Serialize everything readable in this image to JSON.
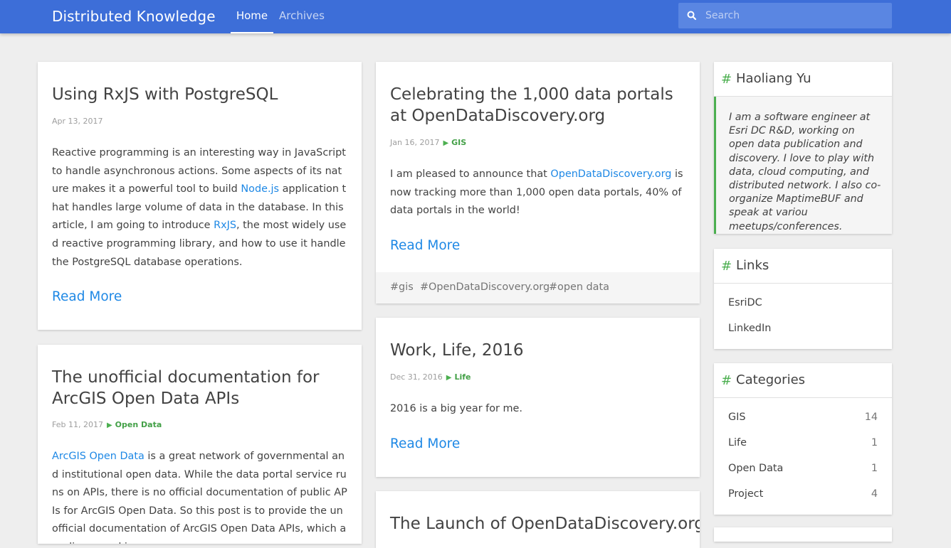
{
  "header": {
    "brand": "Distributed Knowledge",
    "nav": [
      {
        "label": "Home",
        "active": true
      },
      {
        "label": "Archives",
        "active": false
      }
    ],
    "search": {
      "placeholder": "Search",
      "icon": "search-icon"
    }
  },
  "posts_left": [
    {
      "title": "Using RxJS with PostgreSQL",
      "date": "Apr 13, 2017",
      "category": "",
      "body_parts": [
        {
          "text": "Reactive programming is an interesting way in JavaScript to handle asynchronous actions. Some aspects of its nature makes it a powerful tool to build ",
          "link": false
        },
        {
          "text": "Node.js",
          "link": true
        },
        {
          "text": " application that handles large volume of data in the database. In this article, I am going to introduce ",
          "link": false
        },
        {
          "text": "RxJS",
          "link": true
        },
        {
          "text": ", the most widely used reactive programming library, and how to use it handle the PostgreSQL database operations.",
          "link": false
        }
      ],
      "read_more": "Read More"
    },
    {
      "title": "The unofficial documentation for ArcGIS Open Data APIs",
      "date": "Feb 11, 2017",
      "category": "Open Data",
      "body_parts": [
        {
          "text": "ArcGIS Open Data",
          "link": true
        },
        {
          "text": " is a great network of governmental and institutional open data. While the data portal service runs on APIs, there is no official documentation of public APIs for ArcGIS Open Data. So this post is to provide the unofficial documentation of ArcGIS Open Data APIs, which are discovered in m",
          "link": false
        }
      ]
    }
  ],
  "posts_mid": [
    {
      "title": "Celebrating the 1,000 data portals at OpenDataDiscovery.org",
      "date": "Jan 16, 2017",
      "category": "GIS",
      "body_parts": [
        {
          "text": "I am pleased to announce that ",
          "link": false
        },
        {
          "text": "OpenDataDiscovery.org",
          "link": true
        },
        {
          "text": " is now tracking more than 1,000 open data portals, 40% of data portals in the world!",
          "link": false
        }
      ],
      "read_more": "Read More",
      "tags": [
        "#gis",
        "#OpenDataDiscovery.org",
        "#open data"
      ]
    },
    {
      "title": "Work, Life, 2016",
      "date": "Dec 31, 2016",
      "category": "Life",
      "body": "2016 is a big year for me.",
      "read_more": "Read More"
    },
    {
      "title": "The Launch of OpenDataDiscovery.org"
    }
  ],
  "sidebar": {
    "about": {
      "title": "Haoliang Yu",
      "bio": "I am a software engineer at Esri DC R&D, working on open data publication and discovery. I love to play with data, cloud computing, and distributed network. I also co-organize MaptimeBUF and speak at variou meetups/conferences."
    },
    "links": {
      "title": "Links",
      "items": [
        "EsriDC",
        "LinkedIn"
      ]
    },
    "categories": {
      "title": "Categories",
      "items": [
        {
          "name": "GIS",
          "count": "14"
        },
        {
          "name": "Life",
          "count": "1"
        },
        {
          "name": "Open Data",
          "count": "1"
        },
        {
          "name": "Project",
          "count": "4"
        }
      ]
    },
    "hash_symbol": "#"
  },
  "colors": {
    "header": "#3d6ed8",
    "link": "#1e88e5",
    "accent_green": "#4caf50",
    "background": "#eeeeee"
  }
}
